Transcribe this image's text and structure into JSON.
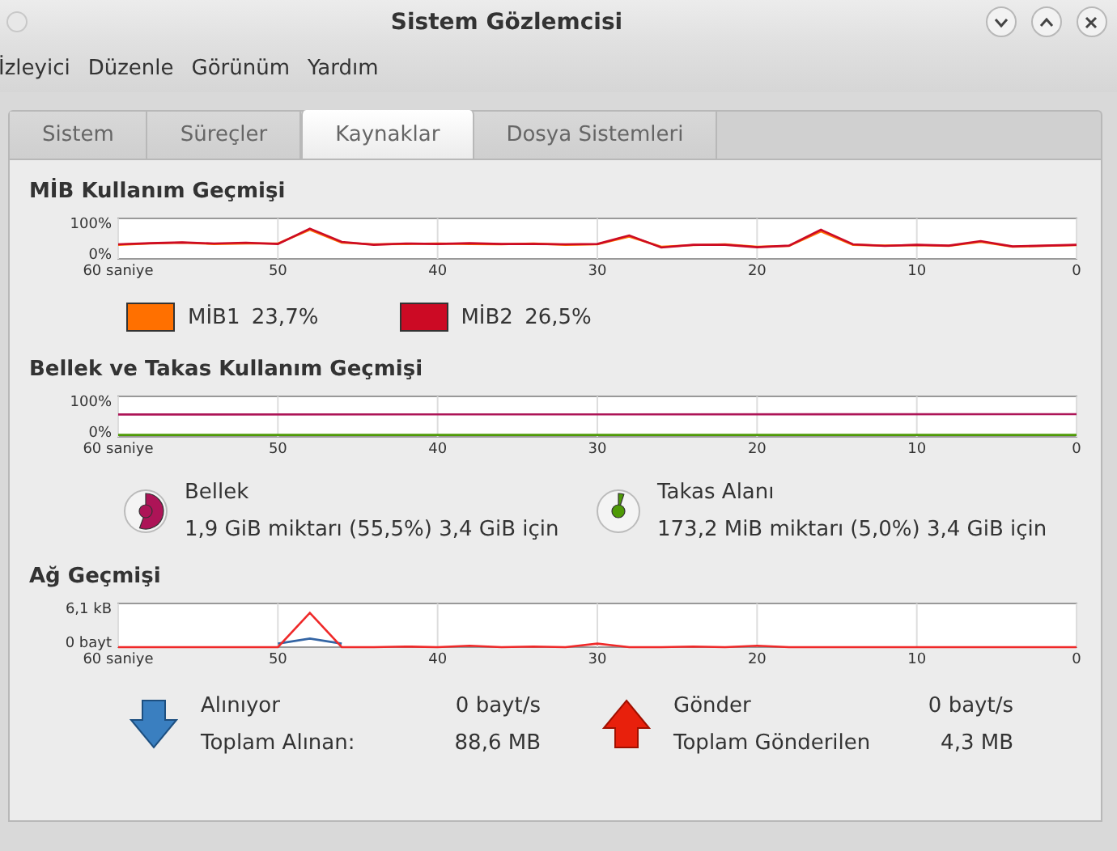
{
  "window": {
    "title": "Sistem Gözlemcisi"
  },
  "menu": [
    "İzleyici",
    "Düzenle",
    "Görünüm",
    "Yardım"
  ],
  "tabs": [
    {
      "label": "Sistem",
      "selected": false
    },
    {
      "label": "Süreçler",
      "selected": false
    },
    {
      "label": "Kaynaklar",
      "selected": true
    },
    {
      "label": "Dosya Sistemleri",
      "selected": false
    }
  ],
  "cpu": {
    "heading": "MİB Kullanım Geçmişi",
    "chart_data": {
      "type": "line",
      "grid": true,
      "x": [
        60,
        58,
        56,
        54,
        52,
        50,
        48,
        46,
        44,
        42,
        40,
        38,
        36,
        34,
        32,
        30,
        28,
        26,
        24,
        22,
        20,
        18,
        16,
        14,
        12,
        10,
        8,
        6,
        4,
        2,
        0
      ],
      "xlim": [
        60,
        0
      ],
      "ylim": [
        0,
        100
      ],
      "xticks": [
        {
          "value": 60,
          "label": "60 saniye"
        },
        50,
        40,
        30,
        20,
        10,
        0
      ],
      "yticks": [
        {
          "value": 0,
          "label": "0%"
        },
        {
          "value": 100,
          "label": "100%"
        }
      ],
      "series": [
        {
          "color": "#ff7000",
          "values": [
            35,
            38,
            40,
            37,
            38,
            38,
            72,
            40,
            36,
            37,
            38,
            37,
            36,
            38,
            35,
            36,
            55,
            30,
            34,
            36,
            30,
            32,
            68,
            35,
            33,
            34,
            32,
            42,
            30,
            32,
            34
          ]
        },
        {
          "color": "#cc0a24",
          "values": [
            36,
            39,
            41,
            38,
            40,
            37,
            75,
            42,
            35,
            38,
            37,
            39,
            37,
            37,
            36,
            37,
            58,
            28,
            35,
            35,
            29,
            33,
            72,
            36,
            32,
            35,
            33,
            44,
            31,
            33,
            35
          ]
        }
      ]
    },
    "legend": [
      {
        "label": "MİB1",
        "value": "23,7%",
        "color": "#ff7000"
      },
      {
        "label": "MİB2",
        "value": "26,5%",
        "color": "#cc0a24"
      }
    ]
  },
  "memory": {
    "heading": "Bellek ve Takas Kullanım Geçmişi",
    "chart_data": {
      "type": "line",
      "grid": true,
      "x": [
        60,
        0
      ],
      "xlim": [
        60,
        0
      ],
      "ylim": [
        0,
        100
      ],
      "xticks": [
        {
          "value": 60,
          "label": "60 saniye"
        },
        50,
        40,
        30,
        20,
        10,
        0
      ],
      "yticks": [
        {
          "value": 0,
          "label": "0%"
        },
        {
          "value": 100,
          "label": "100%"
        }
      ],
      "series": [
        {
          "color": "#ad1457",
          "values": [
            55,
            56
          ]
        },
        {
          "color": "#4e9a06",
          "values": [
            5,
            5
          ]
        }
      ]
    },
    "items": [
      {
        "label": "Bellek",
        "detail": "1,9 GiB miktarı (55,5%) 3,4 GiB için"
      },
      {
        "label": "Takas Alanı",
        "detail": "173,2 MiB miktarı (5,0%) 3,4 GiB için"
      }
    ]
  },
  "network": {
    "heading": "Ağ Geçmişi",
    "chart_data": {
      "type": "line",
      "grid": true,
      "x": [
        60,
        58,
        56,
        54,
        52,
        50,
        48,
        46,
        44,
        42,
        40,
        38,
        36,
        34,
        32,
        30,
        28,
        26,
        24,
        22,
        20,
        18,
        16,
        14,
        12,
        10,
        8,
        6,
        4,
        2,
        0
      ],
      "xlim": [
        60,
        0
      ],
      "ylim": [
        0,
        6.1
      ],
      "xticks": [
        {
          "value": 60,
          "label": "60 saniye"
        },
        50,
        40,
        30,
        20,
        10,
        0
      ],
      "yticks": [
        {
          "value": 0,
          "label": "0 bayt"
        },
        {
          "value": 6.1,
          "label": "6,1 kB"
        }
      ],
      "series": [
        {
          "color": "#3465a4",
          "values": [
            null,
            null,
            null,
            null,
            null,
            0.5,
            1.2,
            0.5,
            null,
            null,
            null,
            null,
            null,
            null,
            null,
            null,
            null,
            null,
            null,
            null,
            null,
            null,
            null,
            null,
            null,
            null,
            null,
            null,
            null,
            null,
            null
          ]
        },
        {
          "color": "#ef2929",
          "values": [
            0,
            0,
            0,
            0,
            0,
            0,
            4.8,
            0,
            0,
            0.1,
            0,
            0.2,
            0,
            0.1,
            0,
            0.5,
            0,
            0,
            0.1,
            0,
            0.2,
            0,
            0,
            0,
            0,
            0,
            0,
            0,
            0,
            0,
            0
          ]
        }
      ]
    },
    "items": [
      {
        "kind": "receive",
        "label": "Alınıyor",
        "rate": "0 bayt/s",
        "total_label": "Toplam Alınan:",
        "total": "88,6 MB"
      },
      {
        "kind": "send",
        "label": "Gönder",
        "rate": "0 bayt/s",
        "total_label": "Toplam Gönderilen",
        "total": "4,3 MB"
      }
    ]
  }
}
